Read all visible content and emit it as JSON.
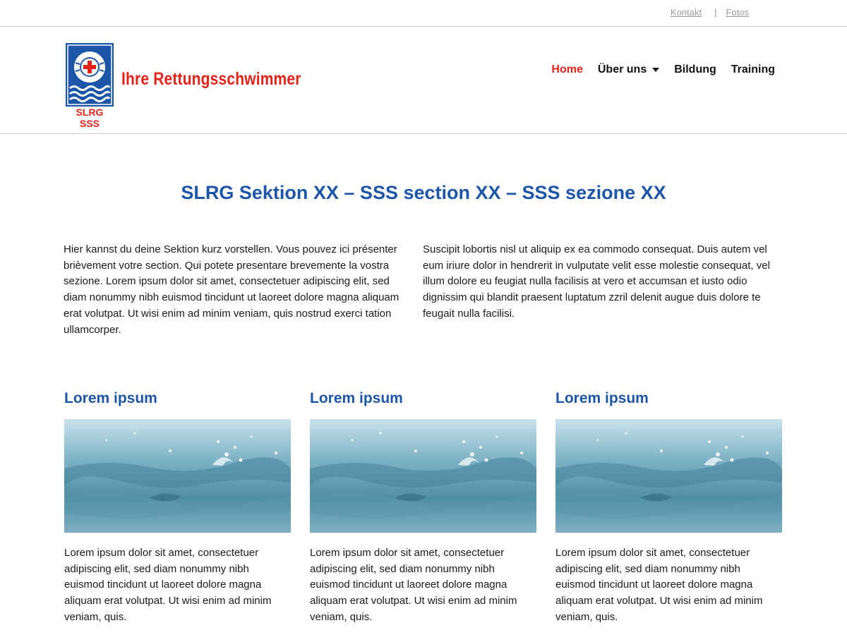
{
  "topbar": {
    "links": [
      {
        "label": "Kontakt"
      },
      {
        "label": "Fotos"
      }
    ],
    "separator": "|"
  },
  "logo": {
    "label": "SLRG SSS",
    "brand_color": "#1d56a8",
    "accent_color": "#e2231a"
  },
  "tagline": "Ihre Rettungsschwimmer",
  "nav": {
    "items": [
      {
        "label": "Home",
        "active": true
      },
      {
        "label": "Über uns",
        "has_dropdown": true
      },
      {
        "label": "Bildung"
      },
      {
        "label": "Training"
      }
    ]
  },
  "main": {
    "title": "SLRG Sektion XX – SSS section XX – SSS sezione XX",
    "intro_left": "Hier kannst du deine Sektion kurz vorstellen. Vous pouvez ici présenter brièvement votre section. Qui potete presentare brevemente la vostra sezione. Lorem ipsum dolor sit amet, consectetuer adipiscing elit, sed diam nonummy nibh euismod tincidunt ut laoreet dolore magna aliquam erat volutpat. Ut wisi enim ad minim veniam, quis nostrud exerci tation ullamcorper.",
    "intro_right": "Suscipit lobortis nisl ut aliquip ex ea commodo consequat. Duis autem vel eum iriure dolor in hendrerit in vulputate velit esse molestie consequat, vel illum dolore eu feugiat nulla facilisis at vero et accumsan et iusto odio dignissim qui blandit praesent luptatum zzril delenit augue duis dolore te feugait nulla facilisi."
  },
  "cards": [
    {
      "title": "Lorem ipsum",
      "image": "water-splash-image",
      "text": "Lorem ipsum dolor sit amet, consectetuer adipiscing elit, sed diam nonummy nibh euismod tincidunt ut laoreet dolore magna aliquam erat volutpat. Ut wisi enim ad minim veniam, quis."
    },
    {
      "title": "Lorem ipsum",
      "image": "water-splash-image",
      "text": "Lorem ipsum dolor sit amet, consectetuer adipiscing elit, sed diam nonummy nibh euismod tincidunt ut laoreet dolore magna aliquam erat volutpat. Ut wisi enim ad minim veniam, quis."
    },
    {
      "title": "Lorem ipsum",
      "image": "water-splash-image",
      "text": "Lorem ipsum dolor sit amet, consectetuer adipiscing elit, sed diam nonummy nibh euismod tincidunt ut laoreet dolore magna aliquam erat volutpat. Ut wisi enim ad minim veniam, quis."
    }
  ]
}
